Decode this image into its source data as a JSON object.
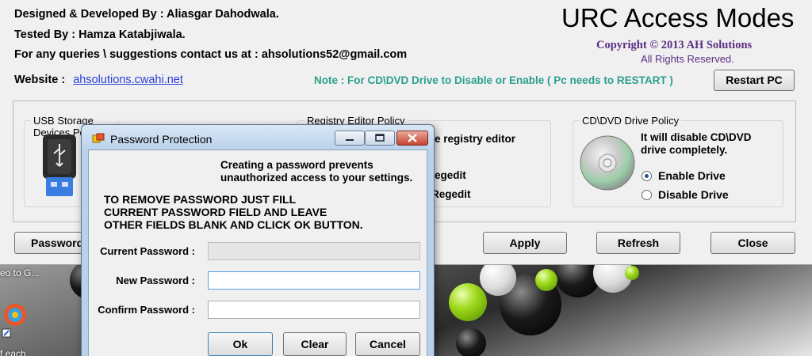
{
  "desktop": {
    "shortcut_label_1": "eo to G...",
    "shortcut_label_2": "f each"
  },
  "main": {
    "designed_by": "Designed & Developed By : Aliasgar Dahodwala.",
    "tested_by": "Tested By : Hamza Katabjiwala.",
    "contact": "For any queries \\ suggestions contact us at : ahsolutions52@gmail.com",
    "website_label": "Website :",
    "website_link": "ahsolutions.cwahi.net",
    "app_title": "URC Access Modes",
    "copyright": "Copyright © 2013 AH Solutions",
    "rights": "All Rights Reserved.",
    "note": "Note : For CD\\DVD Drive to Disable or Enable ( Pc needs to RESTART )",
    "restart_button": "Restart PC",
    "usb_group_title": "USB Storage Devices Policy",
    "registry_group_title": "Registry Editor Policy",
    "registry_desc": "e registry editor",
    "registry_option_1": "egedit",
    "registry_option_2": "Regedit",
    "cd_group_title": "CD\\DVD Drive Policy",
    "cd_desc_line1": "It will disable CD\\DVD",
    "cd_desc_line2": "drive completely.",
    "enable_drive": "Enable Drive",
    "disable_drive": "Disable Drive",
    "password_button": "Password",
    "apply_button": "Apply",
    "refresh_button": "Refresh",
    "close_button": "Close"
  },
  "dialog": {
    "title": "Password Protection",
    "intro_line1": "Creating a password prevents",
    "intro_line2": "unauthorized access to your settings.",
    "instr_line1": "TO REMOVE PASSWORD JUST FILL",
    "instr_line2": "CURRENT PASSWORD FIELD AND LEAVE",
    "instr_line3": "OTHER FIELDS BLANK AND CLICK OK BUTTON.",
    "current_label": "Current Password :",
    "new_label": "New Password :",
    "confirm_label": "Confirm Password :",
    "current_value": "",
    "new_value": "",
    "confirm_value": "",
    "ok_button": "Ok",
    "clear_button": "Clear",
    "cancel_button": "Cancel"
  },
  "colors": {
    "link": "#2b3fd8",
    "copyright": "#5a2d82",
    "note": "#2aa08a",
    "dialog_frame": "#b9d1ea"
  }
}
